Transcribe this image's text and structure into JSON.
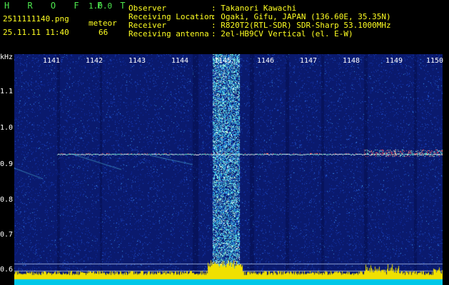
{
  "app": {
    "name": "H R O F F T",
    "version": "1.0.0"
  },
  "file": {
    "name": "2511111140.png",
    "datetime": "25.11.11 11:40"
  },
  "meteor": {
    "label": "meteor",
    "count": "66"
  },
  "info": [
    {
      "key": "Observer",
      "value": ": Takanori Kawachi"
    },
    {
      "key": "Receiving Location",
      "value": ": Ogaki, Gifu, JAPAN (136.60E, 35.35N)"
    },
    {
      "key": "Receiver",
      "value": ": R820T2(RTL-SDR) SDR-Sharp 53.1000MHz"
    },
    {
      "key": "Receiving antenna",
      "value": ": 2el-HB9CV Vertical (el. E-W)"
    }
  ],
  "axis": {
    "unit": "kHz",
    "y_ticks": [
      "1.1",
      "1.0",
      "0.9",
      "0.8",
      "0.7",
      "0.6"
    ],
    "x_ticks": [
      "1141",
      "1142",
      "1143",
      "1144",
      "1145",
      "1146",
      "1147",
      "1148",
      "1149",
      "1150"
    ]
  },
  "colors": {
    "text_green": "#4ee84e",
    "text_yellow": "#ffff22",
    "background": "#000000"
  }
}
